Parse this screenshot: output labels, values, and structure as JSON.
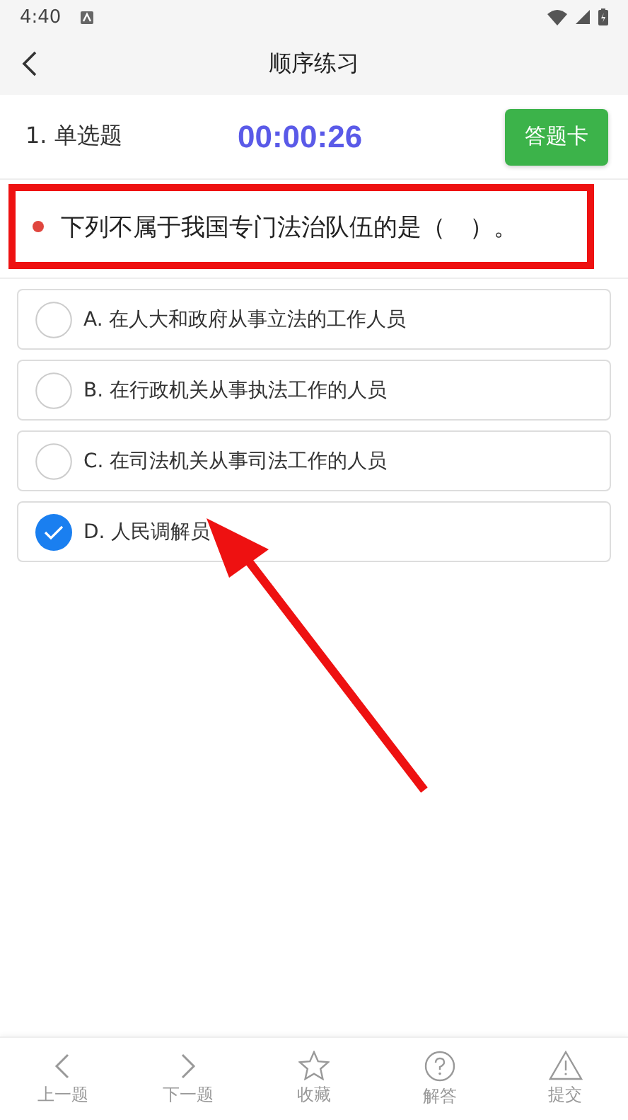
{
  "status_bar": {
    "time": "4:40"
  },
  "header": {
    "title": "顺序练习"
  },
  "question_bar": {
    "type_label": "1. 单选题",
    "timer": "00:00:26",
    "card_button": "答题卡"
  },
  "question": {
    "text": "下列不属于我国专门法治队伍的是（　）。",
    "highlighted": true
  },
  "options": [
    {
      "text": "A. 在人大和政府从事立法的工作人员",
      "selected": false
    },
    {
      "text": "B. 在行政机关从事执法工作的人员",
      "selected": false
    },
    {
      "text": "C. 在司法机关从事司法工作的人员",
      "selected": false
    },
    {
      "text": "D. 人民调解员",
      "selected": true
    }
  ],
  "annotation": {
    "kind": "arrow"
  },
  "bottom_nav": [
    {
      "kind": "prev",
      "label": "上一题"
    },
    {
      "kind": "next",
      "label": "下一题"
    },
    {
      "kind": "star",
      "label": "收藏"
    },
    {
      "kind": "help",
      "label": "解答"
    },
    {
      "kind": "warning",
      "label": "提交"
    }
  ]
}
